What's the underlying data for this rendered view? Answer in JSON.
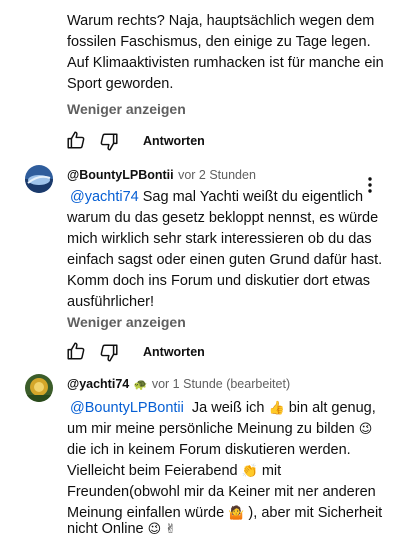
{
  "comment1": {
    "lines": [
      "Warum rechts? Naja, hauptsächlich wegen dem",
      "fossilen Faschismus, den einige zu Tage legen.",
      "Auf Klimaaktivisten rumhacken ist für manche ein",
      "Sport geworden."
    ],
    "show_less": "Weniger anzeigen",
    "reply": "Antworten"
  },
  "comment2": {
    "author": "@BountyLPBontii",
    "time": "vor 2 Stunden",
    "mention": "@yachti74",
    "line1_rest": " Sag mal Yachti weißt du eigentlich",
    "lines": [
      "warum du das gesetz bekloppt nennst, es würde",
      "mich wirklich sehr stark interessieren ob du das",
      "einfach sagst oder einen guten Grund dafür hast.",
      "Komm doch ins Forum und diskutier dort etwas",
      "ausführlicher!"
    ],
    "show_less": "Weniger anzeigen",
    "reply": "Antworten",
    "menu_icon": "more-vertical-icon"
  },
  "comment3": {
    "author": "@yachti74",
    "author_badge": "🐢",
    "time": "vor 1 Stunde (bearbeitet)",
    "mention": "@BountyLPBontii",
    "line1_a": "  Ja weiß ich ",
    "emoji_thumb": "👍",
    "line1_b": " bin alt genug,",
    "line2_a": "um mir meine persönliche Meinung zu bilden ",
    "emoji_wink": "😉",
    "line3": "die ich in keinem Forum diskutieren werden.",
    "line4_a": "Vielleicht beim Feierabend ",
    "emoji_clap": "👏",
    "line4_b": " mit",
    "line5": "Freunden(obwohl mir da Keiner mit ner anderen",
    "line6_a": "Meinung einfallen würde ",
    "emoji_shrug": "🤷",
    "line6_b": " ), aber mit Sicherheit",
    "line7_a": "nicht Online ",
    "emoji_wink2": "😉",
    "emoji_peace": "✌"
  },
  "colors": {
    "link": "#065fd4",
    "secondary_text": "#606060",
    "text": "#0f0f0f"
  }
}
